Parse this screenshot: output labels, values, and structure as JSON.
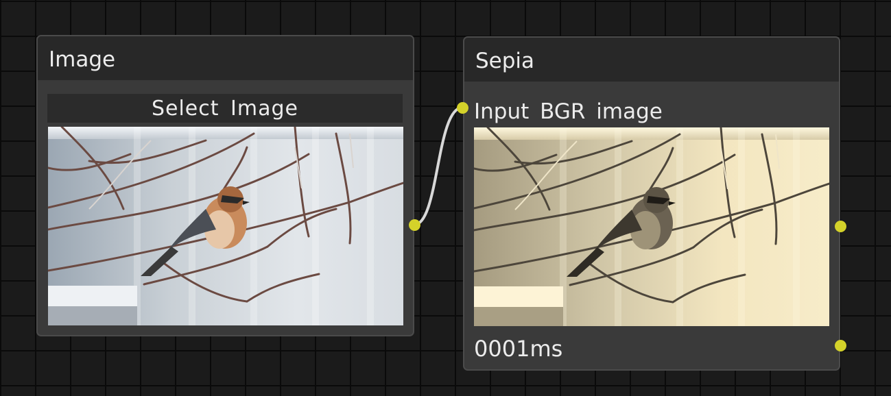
{
  "nodes": {
    "image": {
      "title": "Image",
      "select_button_label": "Select Image"
    },
    "sepia": {
      "title": "Sepia",
      "input_label": "Input BGR image",
      "processing_time": "0001ms"
    }
  },
  "colors": {
    "canvas_background": "#1b1b1b",
    "grid_line": "#0a0a0a",
    "node_body": "#3a3a3a",
    "node_header": "#282828",
    "port": "#d4d22a",
    "wire": "#d8d8d8",
    "text": "#ececec"
  }
}
